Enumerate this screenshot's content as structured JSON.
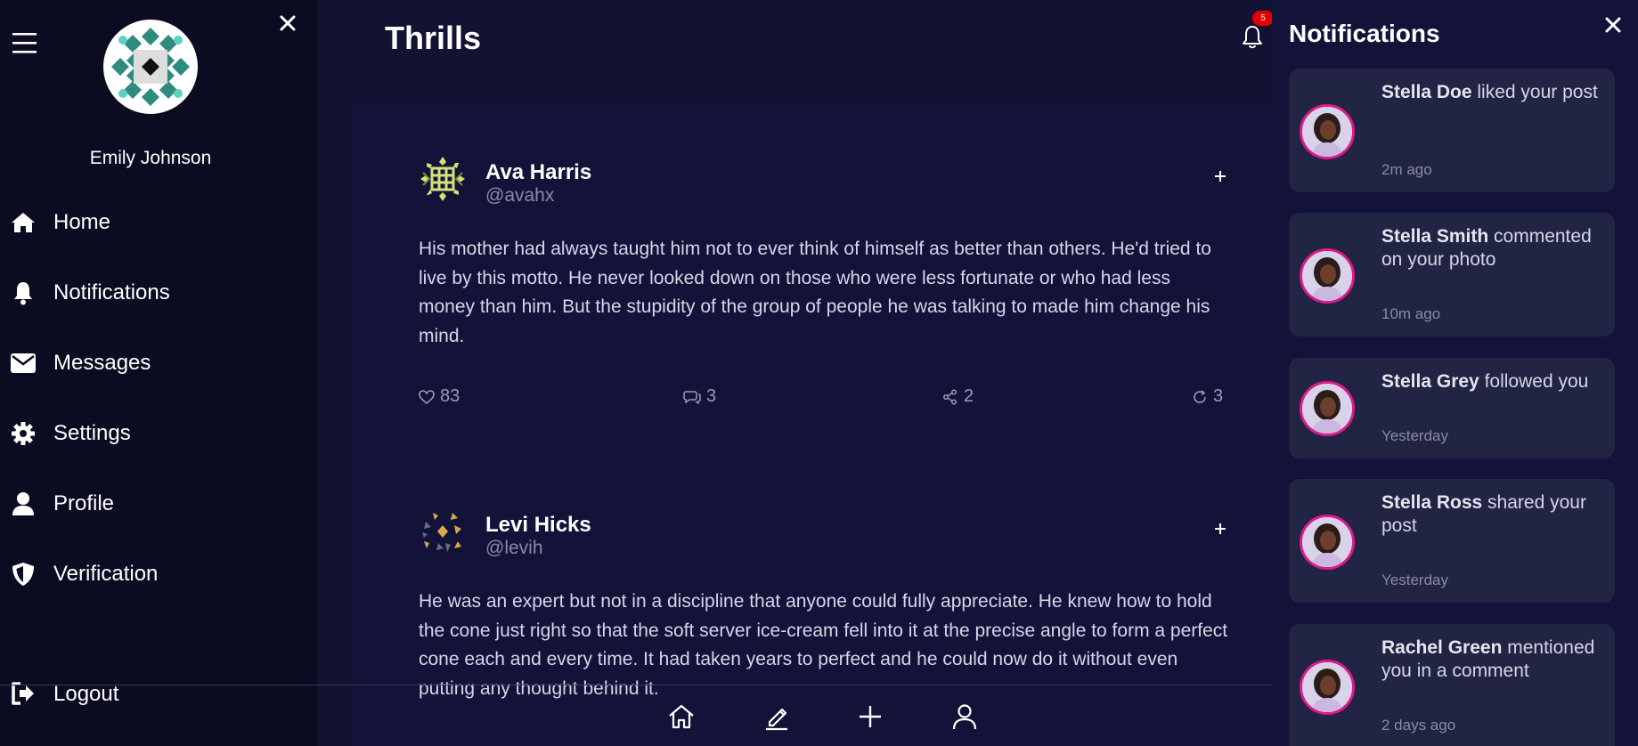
{
  "sidebar": {
    "username": "Emily Johnson",
    "items": [
      {
        "label": "Home",
        "icon": "home-icon"
      },
      {
        "label": "Notifications",
        "icon": "bell-icon"
      },
      {
        "label": "Messages",
        "icon": "envelope-icon"
      },
      {
        "label": "Settings",
        "icon": "gear-icon"
      },
      {
        "label": "Profile",
        "icon": "user-icon"
      },
      {
        "label": "Verification",
        "icon": "shield-icon"
      }
    ],
    "logout_label": "Logout"
  },
  "header": {
    "title": "Thrills",
    "notification_count": "5"
  },
  "posts": [
    {
      "name": "Ava Harris",
      "handle": "@avahx",
      "text": "His mother had always taught him not to ever think of himself as better than others. He'd tried to live by this motto. He never looked down on those who were less fortunate or who had less money than him. But the stupidity of the group of people he was talking to made him change his mind.",
      "likes": "83",
      "comments": "3",
      "shares": "2",
      "reposts": "3"
    },
    {
      "name": "Levi Hicks",
      "handle": "@levih",
      "text": "He was an expert but not in a discipline that anyone could fully appreciate. He knew how to hold the cone just right so that the soft server ice-cream fell into it at the precise angle to form a perfect cone each and every time. It had taken years to perfect and he could now do it without even putting any thought behind it."
    }
  ],
  "notifications": {
    "title": "Notifications",
    "items": [
      {
        "name": "Stella Doe",
        "action": " liked your post",
        "time": "2m ago"
      },
      {
        "name": "Stella Smith",
        "action": " commented on your photo",
        "time": "10m ago"
      },
      {
        "name": "Stella Grey",
        "action": " followed you",
        "time": "Yesterday"
      },
      {
        "name": "Stella Ross",
        "action": " shared your post",
        "time": "Yesterday"
      },
      {
        "name": "Rachel Green",
        "action": " mentioned you in a comment",
        "time": "2 days ago"
      }
    ]
  },
  "colors": {
    "background": "#12122e",
    "sidebar": "#0b0b22",
    "card": "#222444",
    "accent_pink": "#e0198a",
    "badge_red": "#e00000"
  }
}
